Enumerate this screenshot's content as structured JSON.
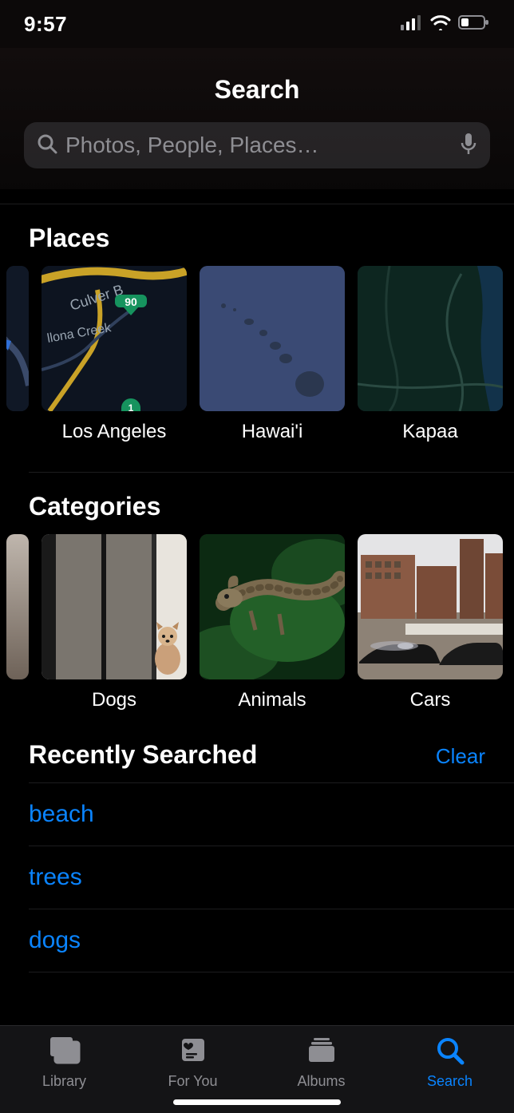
{
  "status": {
    "time": "9:57"
  },
  "header": {
    "title": "Search"
  },
  "search": {
    "placeholder": "Photos, People, Places…",
    "value": ""
  },
  "colors": {
    "accent": "#0a84ff"
  },
  "sections": {
    "places": {
      "title": "Places",
      "items": [
        {
          "label": "Los Angeles"
        },
        {
          "label": "Hawai'i"
        },
        {
          "label": "Kapaa"
        }
      ]
    },
    "categories": {
      "title": "Categories",
      "items": [
        {
          "label": "Dogs"
        },
        {
          "label": "Animals"
        },
        {
          "label": "Cars"
        }
      ]
    },
    "recent": {
      "title": "Recently Searched",
      "clear_label": "Clear",
      "items": [
        "beach",
        "trees",
        "dogs"
      ]
    }
  },
  "tabs": {
    "library": "Library",
    "for_you": "For You",
    "albums": "Albums",
    "search": "Search"
  }
}
